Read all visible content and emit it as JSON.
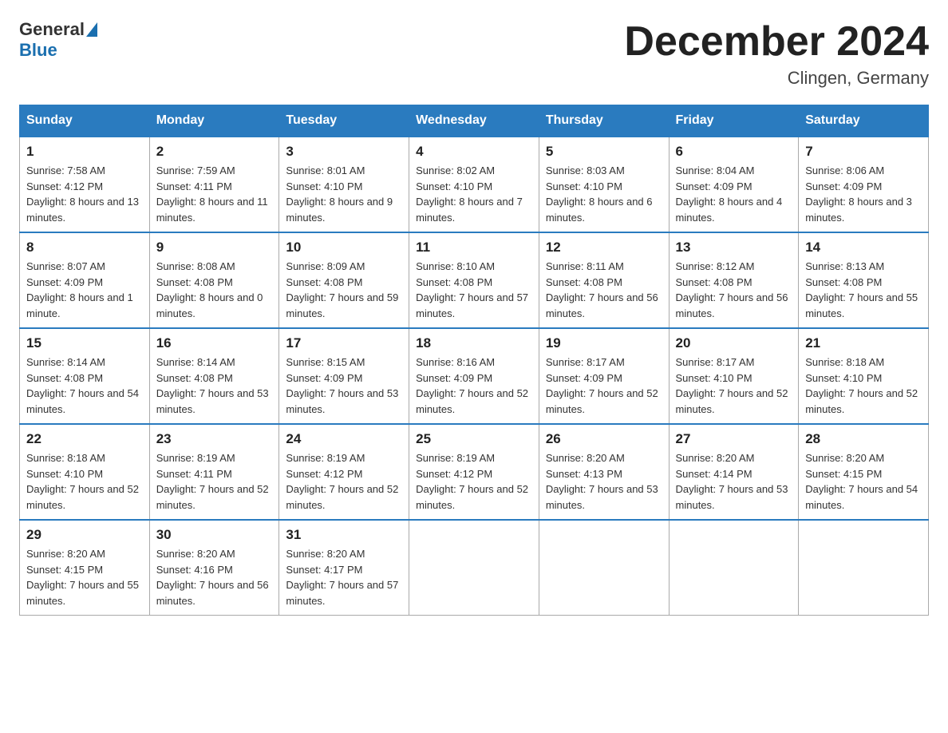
{
  "header": {
    "logo_general": "General",
    "logo_blue": "Blue",
    "month_title": "December 2024",
    "location": "Clingen, Germany"
  },
  "days_of_week": [
    "Sunday",
    "Monday",
    "Tuesday",
    "Wednesday",
    "Thursday",
    "Friday",
    "Saturday"
  ],
  "weeks": [
    [
      {
        "day": "1",
        "sunrise": "7:58 AM",
        "sunset": "4:12 PM",
        "daylight": "8 hours and 13 minutes."
      },
      {
        "day": "2",
        "sunrise": "7:59 AM",
        "sunset": "4:11 PM",
        "daylight": "8 hours and 11 minutes."
      },
      {
        "day": "3",
        "sunrise": "8:01 AM",
        "sunset": "4:10 PM",
        "daylight": "8 hours and 9 minutes."
      },
      {
        "day": "4",
        "sunrise": "8:02 AM",
        "sunset": "4:10 PM",
        "daylight": "8 hours and 7 minutes."
      },
      {
        "day": "5",
        "sunrise": "8:03 AM",
        "sunset": "4:10 PM",
        "daylight": "8 hours and 6 minutes."
      },
      {
        "day": "6",
        "sunrise": "8:04 AM",
        "sunset": "4:09 PM",
        "daylight": "8 hours and 4 minutes."
      },
      {
        "day": "7",
        "sunrise": "8:06 AM",
        "sunset": "4:09 PM",
        "daylight": "8 hours and 3 minutes."
      }
    ],
    [
      {
        "day": "8",
        "sunrise": "8:07 AM",
        "sunset": "4:09 PM",
        "daylight": "8 hours and 1 minute."
      },
      {
        "day": "9",
        "sunrise": "8:08 AM",
        "sunset": "4:08 PM",
        "daylight": "8 hours and 0 minutes."
      },
      {
        "day": "10",
        "sunrise": "8:09 AM",
        "sunset": "4:08 PM",
        "daylight": "7 hours and 59 minutes."
      },
      {
        "day": "11",
        "sunrise": "8:10 AM",
        "sunset": "4:08 PM",
        "daylight": "7 hours and 57 minutes."
      },
      {
        "day": "12",
        "sunrise": "8:11 AM",
        "sunset": "4:08 PM",
        "daylight": "7 hours and 56 minutes."
      },
      {
        "day": "13",
        "sunrise": "8:12 AM",
        "sunset": "4:08 PM",
        "daylight": "7 hours and 56 minutes."
      },
      {
        "day": "14",
        "sunrise": "8:13 AM",
        "sunset": "4:08 PM",
        "daylight": "7 hours and 55 minutes."
      }
    ],
    [
      {
        "day": "15",
        "sunrise": "8:14 AM",
        "sunset": "4:08 PM",
        "daylight": "7 hours and 54 minutes."
      },
      {
        "day": "16",
        "sunrise": "8:14 AM",
        "sunset": "4:08 PM",
        "daylight": "7 hours and 53 minutes."
      },
      {
        "day": "17",
        "sunrise": "8:15 AM",
        "sunset": "4:09 PM",
        "daylight": "7 hours and 53 minutes."
      },
      {
        "day": "18",
        "sunrise": "8:16 AM",
        "sunset": "4:09 PM",
        "daylight": "7 hours and 52 minutes."
      },
      {
        "day": "19",
        "sunrise": "8:17 AM",
        "sunset": "4:09 PM",
        "daylight": "7 hours and 52 minutes."
      },
      {
        "day": "20",
        "sunrise": "8:17 AM",
        "sunset": "4:10 PM",
        "daylight": "7 hours and 52 minutes."
      },
      {
        "day": "21",
        "sunrise": "8:18 AM",
        "sunset": "4:10 PM",
        "daylight": "7 hours and 52 minutes."
      }
    ],
    [
      {
        "day": "22",
        "sunrise": "8:18 AM",
        "sunset": "4:10 PM",
        "daylight": "7 hours and 52 minutes."
      },
      {
        "day": "23",
        "sunrise": "8:19 AM",
        "sunset": "4:11 PM",
        "daylight": "7 hours and 52 minutes."
      },
      {
        "day": "24",
        "sunrise": "8:19 AM",
        "sunset": "4:12 PM",
        "daylight": "7 hours and 52 minutes."
      },
      {
        "day": "25",
        "sunrise": "8:19 AM",
        "sunset": "4:12 PM",
        "daylight": "7 hours and 52 minutes."
      },
      {
        "day": "26",
        "sunrise": "8:20 AM",
        "sunset": "4:13 PM",
        "daylight": "7 hours and 53 minutes."
      },
      {
        "day": "27",
        "sunrise": "8:20 AM",
        "sunset": "4:14 PM",
        "daylight": "7 hours and 53 minutes."
      },
      {
        "day": "28",
        "sunrise": "8:20 AM",
        "sunset": "4:15 PM",
        "daylight": "7 hours and 54 minutes."
      }
    ],
    [
      {
        "day": "29",
        "sunrise": "8:20 AM",
        "sunset": "4:15 PM",
        "daylight": "7 hours and 55 minutes."
      },
      {
        "day": "30",
        "sunrise": "8:20 AM",
        "sunset": "4:16 PM",
        "daylight": "7 hours and 56 minutes."
      },
      {
        "day": "31",
        "sunrise": "8:20 AM",
        "sunset": "4:17 PM",
        "daylight": "7 hours and 57 minutes."
      },
      null,
      null,
      null,
      null
    ]
  ]
}
